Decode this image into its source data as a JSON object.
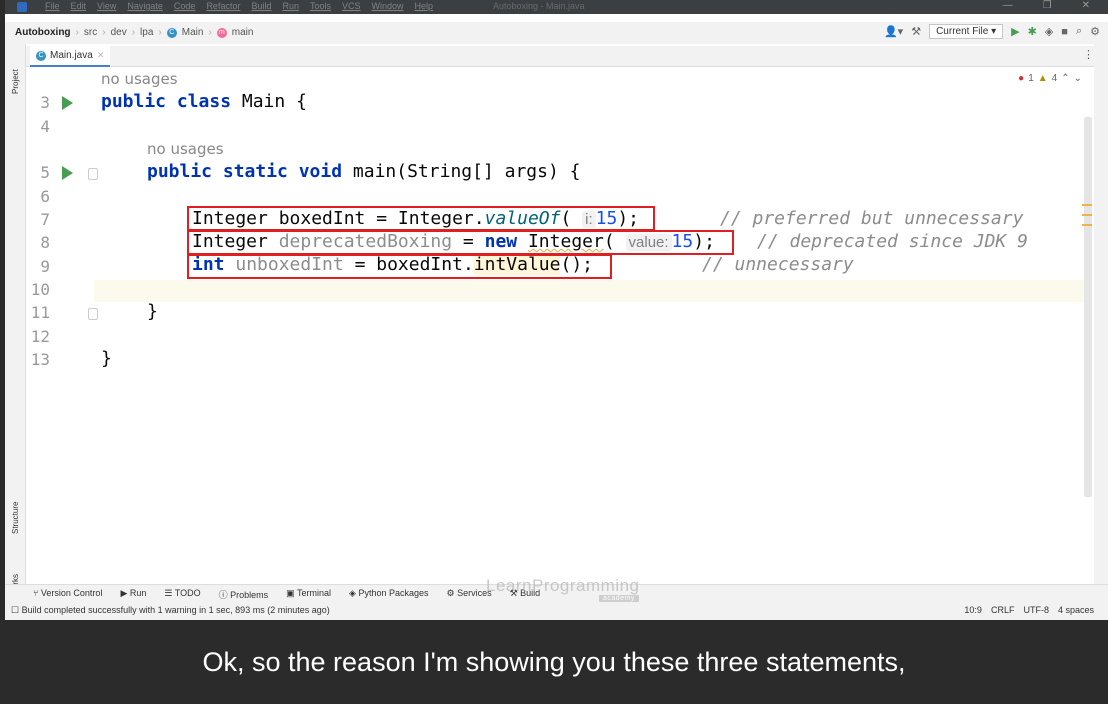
{
  "menubar": {
    "items": [
      "File",
      "Edit",
      "View",
      "Navigate",
      "Code",
      "Refactor",
      "Build",
      "Run",
      "Tools",
      "VCS",
      "Window",
      "Help"
    ],
    "window_title": "Autoboxing - Main.java"
  },
  "navbar": {
    "project": "Autoboxing",
    "crumbs": [
      "src",
      "dev",
      "lpa",
      "Main",
      "main"
    ],
    "run_config": "Current File"
  },
  "side_tools": {
    "project": "Project",
    "structure": "Structure",
    "bookmarks": "Bookmarks"
  },
  "editor_tab": {
    "label": "Main.java"
  },
  "inspections": {
    "errors": "1",
    "warnings": "4"
  },
  "editor": {
    "usage_hint": "no usages",
    "line_numbers": [
      "3",
      "4",
      "5",
      "6",
      "7",
      "8",
      "9",
      "10",
      "11",
      "12",
      "13"
    ],
    "line3": {
      "kw": "public class",
      "rest": " Main {"
    },
    "line5": {
      "kw": "public static void",
      "rest": " main(String[] args) {"
    },
    "line7": {
      "a": "Integer boxedInt = Integer.",
      "method": "valueOf",
      "b": "( ",
      "hint": "i:",
      "num": "15",
      "c": ");",
      "comment": "// preferred but unnecessary"
    },
    "line8": {
      "a": "Integer ",
      "var": "deprecatedBoxing",
      "b": " = ",
      "kw": "new",
      "c": " ",
      "cls": "Integer",
      "d": "( ",
      "hint": "value:",
      "num": "15",
      "e": ");",
      "comment": "// deprecated since JDK 9"
    },
    "line9": {
      "kw": "int",
      "var": " unboxedInt",
      "a": " = boxedInt.",
      "method": "intValue",
      "b": "();",
      "comment": "// unnecessary"
    },
    "close_brace": "}"
  },
  "bottom_tools": [
    "Version Control",
    "Run",
    "TODO",
    "Problems",
    "Terminal",
    "Python Packages",
    "Services",
    "Build"
  ],
  "status": {
    "message": "Build completed successfully with 1 warning in 1 sec, 893 ms (2 minutes ago)",
    "position": "10:9",
    "line_sep": "CRLF",
    "encoding": "UTF-8",
    "indent": "4 spaces"
  },
  "watermark": {
    "text": "LearnProgramming",
    "sub": "academy"
  },
  "caption": "Ok, so the reason I'm showing you these three statements,"
}
